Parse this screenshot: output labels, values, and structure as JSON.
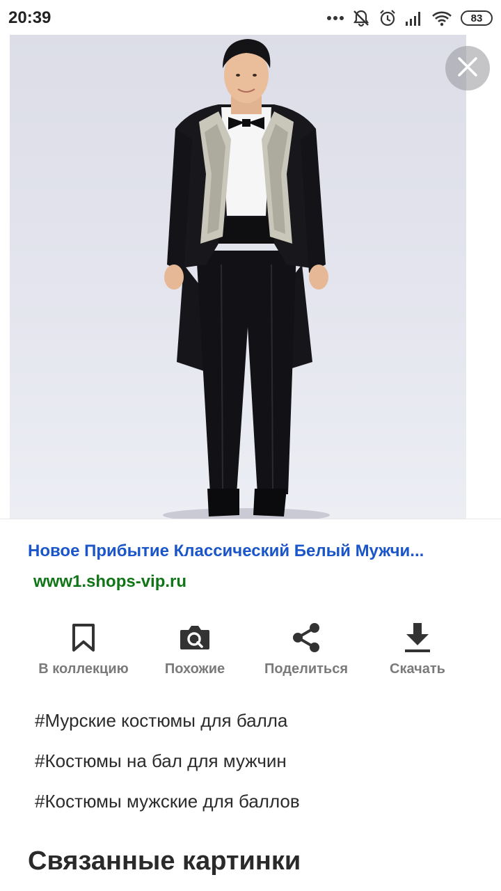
{
  "status_bar": {
    "time": "20:39",
    "icons": [
      "dots-icon",
      "notifications-off-icon",
      "alarm-icon",
      "signal-icon",
      "wifi-icon",
      "battery-icon"
    ],
    "battery": "83"
  },
  "image_viewer": {
    "image_subject": "man-in-tailcoat-photo",
    "close_icon": "close-icon"
  },
  "result": {
    "title": "Новое Прибытие Классический Белый Мужчи...",
    "url": "www1.shops-vip.ru"
  },
  "actions": [
    {
      "label": "В коллекцию",
      "icon": "bookmark-icon"
    },
    {
      "label": "Похожие",
      "icon": "camera-search-icon"
    },
    {
      "label": "Поделиться",
      "icon": "share-icon"
    },
    {
      "label": "Скачать",
      "icon": "download-icon"
    }
  ],
  "tags": [
    "#Мурские костюмы для балла",
    "#Костюмы на бал для мужчин",
    "#Костюмы мужские для баллов"
  ],
  "related": {
    "heading": "Связанные картинки"
  },
  "colors": {
    "title_link": "#1a55c9",
    "url": "#107516",
    "action_label": "#7a7a7a"
  }
}
